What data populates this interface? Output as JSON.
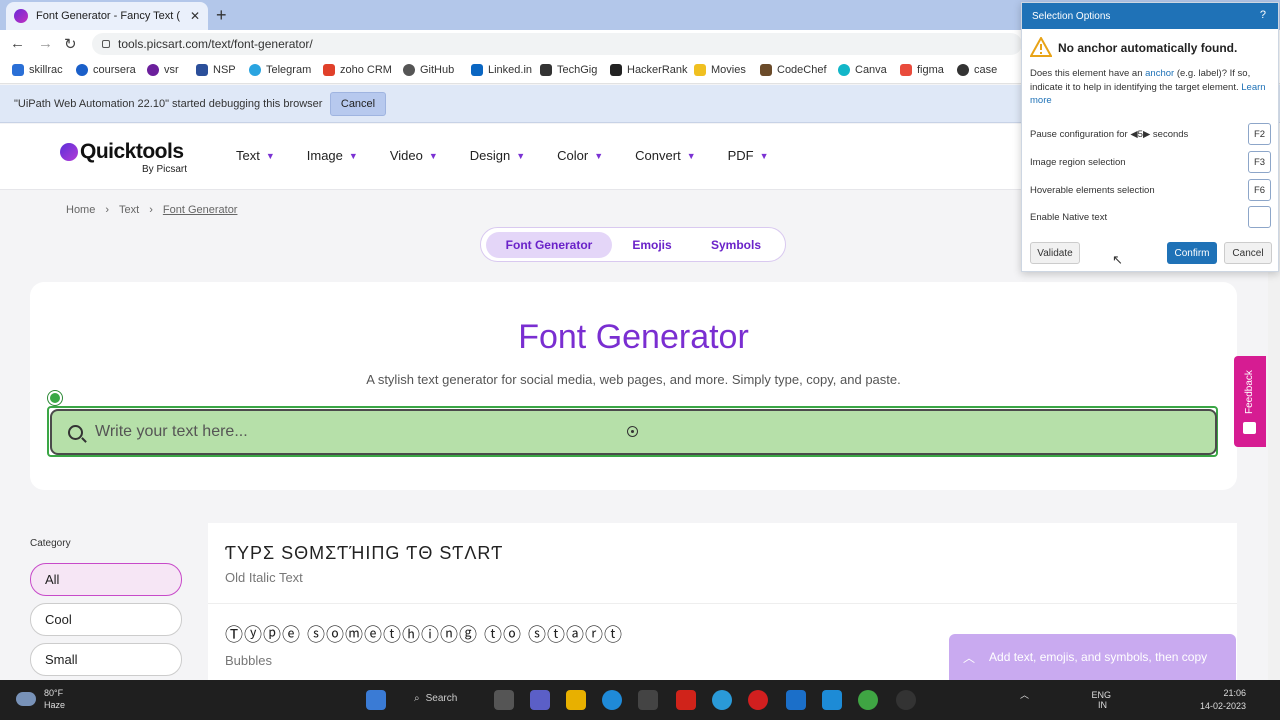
{
  "browser": {
    "tab_title": "Font Generator - Fancy Text ( Co",
    "url": "tools.picsart.com/text/font-generator/",
    "bookmarks": [
      "skillrac",
      "coursera",
      "vsr",
      "NSP",
      "Telegram",
      "zoho CRM",
      "GitHub",
      "Linked.in",
      "TechGig",
      "HackerRank",
      "Movies",
      "CodeChef",
      "Canva",
      "figma",
      "case"
    ],
    "debug_message": "\"UiPath Web Automation 22.10\" started debugging this browser",
    "debug_cancel": "Cancel"
  },
  "site": {
    "logo_name": "Quicktools",
    "logo_by": "By Picsart",
    "menu": [
      "Text",
      "Image",
      "Video",
      "Design",
      "Color",
      "Convert",
      "PDF"
    ],
    "breadcrumb": [
      "Home",
      "Text",
      "Font Generator"
    ],
    "segments": [
      "Font Generator",
      "Emojis",
      "Symbols"
    ],
    "title": "Font Generator",
    "subtitle": "A stylish text generator for social media, web pages, and more. Simply type, copy, and paste.",
    "search_placeholder": "Write your text here...",
    "category_label": "Category",
    "categories": [
      "All",
      "Cool",
      "Small"
    ],
    "results": [
      {
        "preview": "ƬΥPΣ SΘMΣƬΉIΠG ƬΘ SƬΛRƬ",
        "label": "Old Italic Text"
      },
      {
        "preview": "Ⓣⓨⓟⓔ ⓢⓞⓜⓔⓣⓗⓘⓝⓖ ⓣⓞ ⓢⓣⓐⓡⓣ",
        "label": "Bubbles"
      }
    ],
    "toast": "Add text, emojis, and symbols, then copy",
    "feedback": "Feedback"
  },
  "dialog": {
    "title": "Selection Options",
    "help": "?",
    "warning": "No anchor automatically found.",
    "desc_before": "Does this element have an ",
    "desc_link": "anchor",
    "desc_after": " (e.g. label)? If so, indicate it to help in identifying the target element. ",
    "learn_more": "Learn more",
    "pause_label": "Pause configuration for",
    "pause_value": "5",
    "pause_unit": "seconds",
    "options": [
      {
        "label": "Image region selection",
        "key": "F3"
      },
      {
        "label": "Hoverable elements selection",
        "key": "F6"
      },
      {
        "label": "Enable Native text",
        "key": ""
      }
    ],
    "pause_key": "F2",
    "validate": "Validate",
    "confirm": "Confirm",
    "cancel": "Cancel"
  },
  "taskbar": {
    "temp": "80°F",
    "weather": "Haze",
    "search": "Search",
    "lang": "ENG",
    "region": "IN",
    "time": "21:06",
    "date": "14-02-2023"
  },
  "colors": {
    "brand_purple": "#7a2ed1",
    "uipath_blue": "#1f72b7",
    "highlight_green": "#b6e0a9",
    "feedback_pink": "#d61c92"
  }
}
